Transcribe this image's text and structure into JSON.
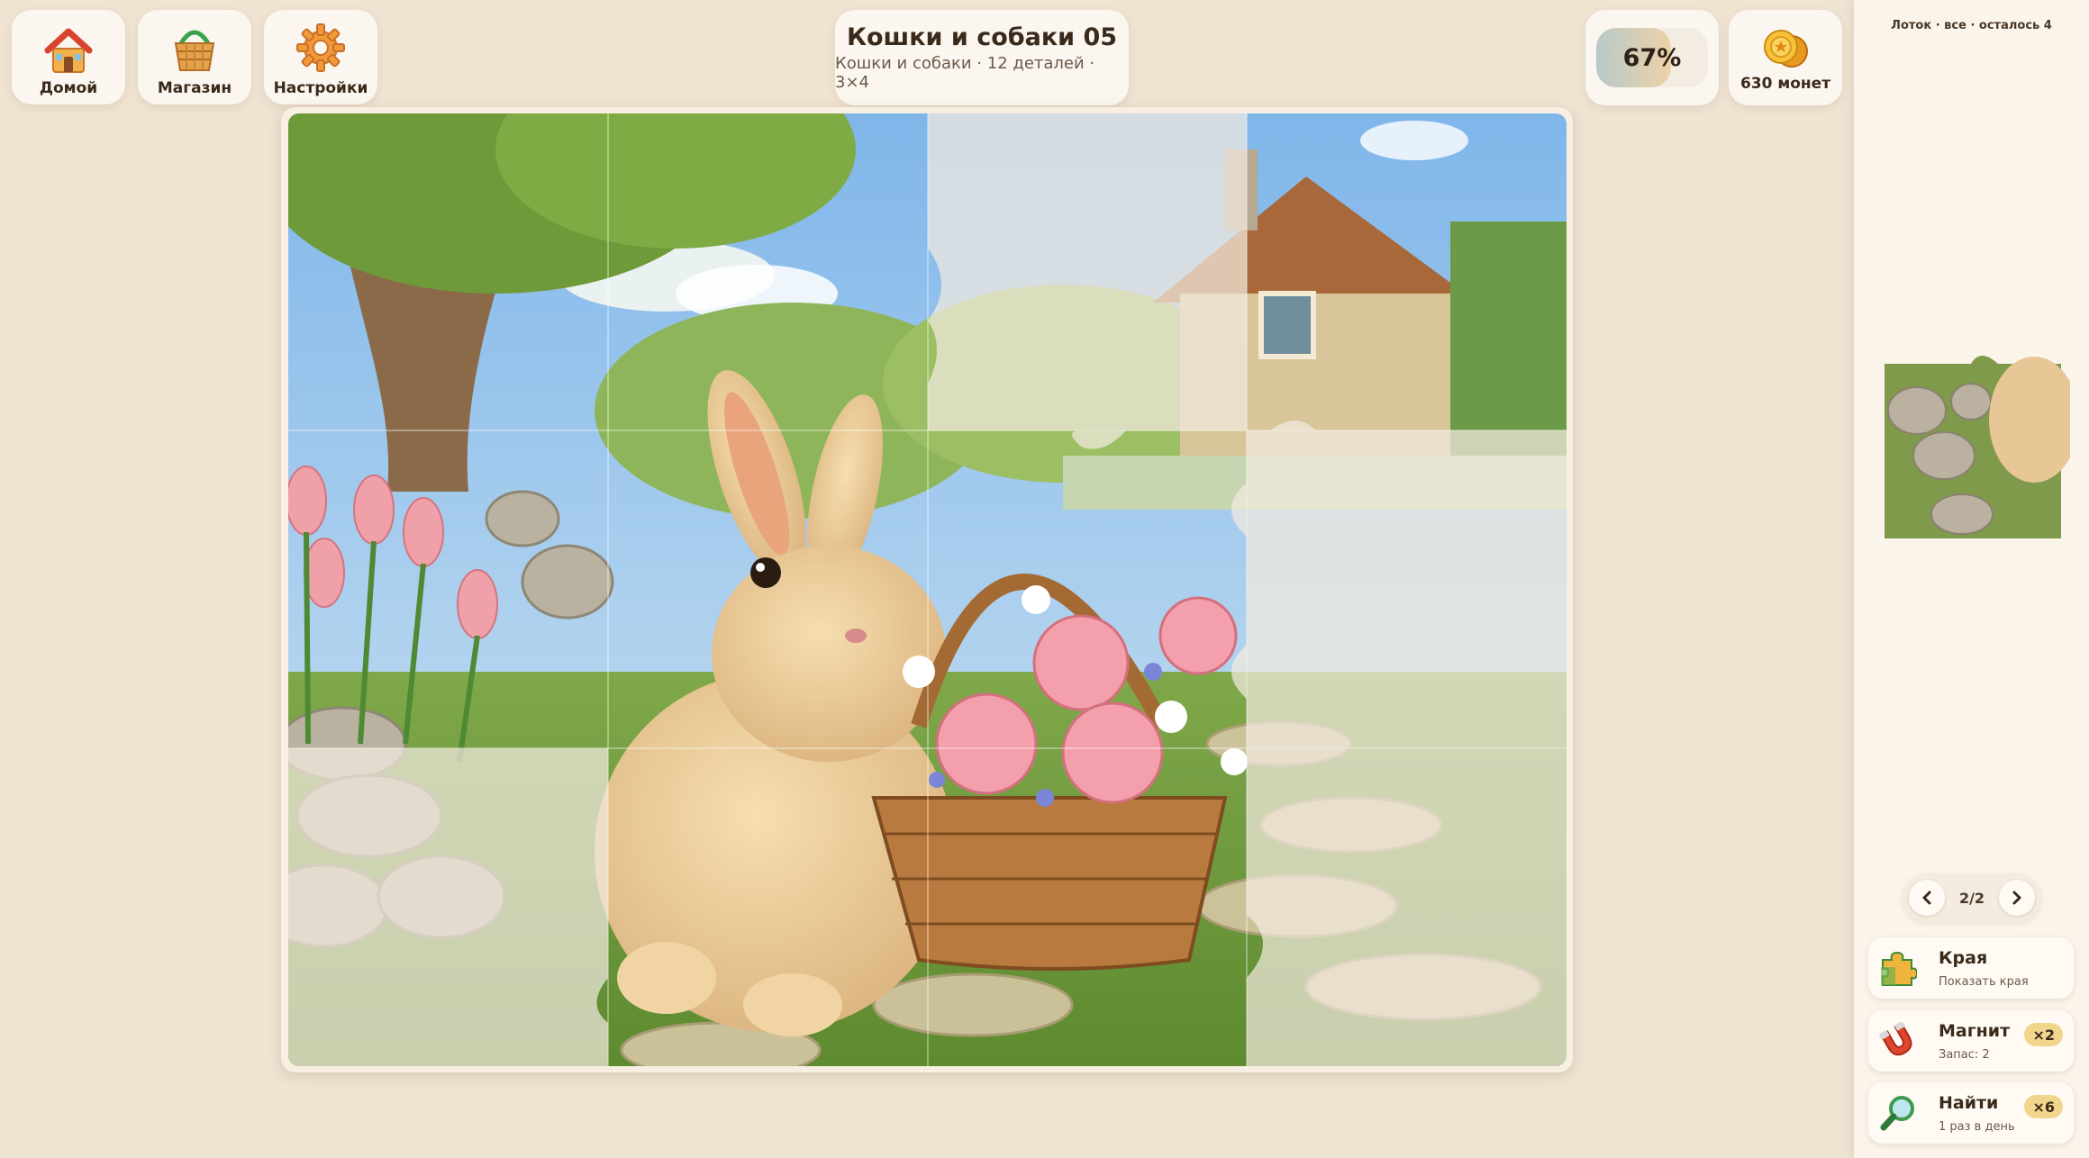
{
  "nav": {
    "home_label": "Домой",
    "shop_label": "Магазин",
    "settings_label": "Настройки"
  },
  "puzzle": {
    "title": "Кошки и собаки 05",
    "subtitle": "Кошки и собаки · 12 деталей · 3×4",
    "progress_label": "67%",
    "progress_value": 0.67
  },
  "coins": {
    "label": "630 монет"
  },
  "tray": {
    "status": "Лоток · все · осталось 4",
    "pager_label": "2/2"
  },
  "tools": [
    {
      "name": "Края",
      "description": "Показать края",
      "count": ""
    },
    {
      "name": "Магнит",
      "description": "Запас: 2",
      "count": "×2"
    },
    {
      "name": "Найти",
      "description": "1 раз в день",
      "count": "×6"
    }
  ],
  "colors": {
    "background": "#efe3d2",
    "panel": "#fbf6ef",
    "badge": "#f1d58d",
    "accent_orange": "#f08a2a"
  },
  "icons": {
    "home": "house-icon",
    "shop": "basket-icon",
    "settings": "gear-icon",
    "coins": "coin-icon",
    "edges": "puzzle-piece-icon",
    "magnet": "magnet-icon",
    "find": "magnifier-icon"
  }
}
